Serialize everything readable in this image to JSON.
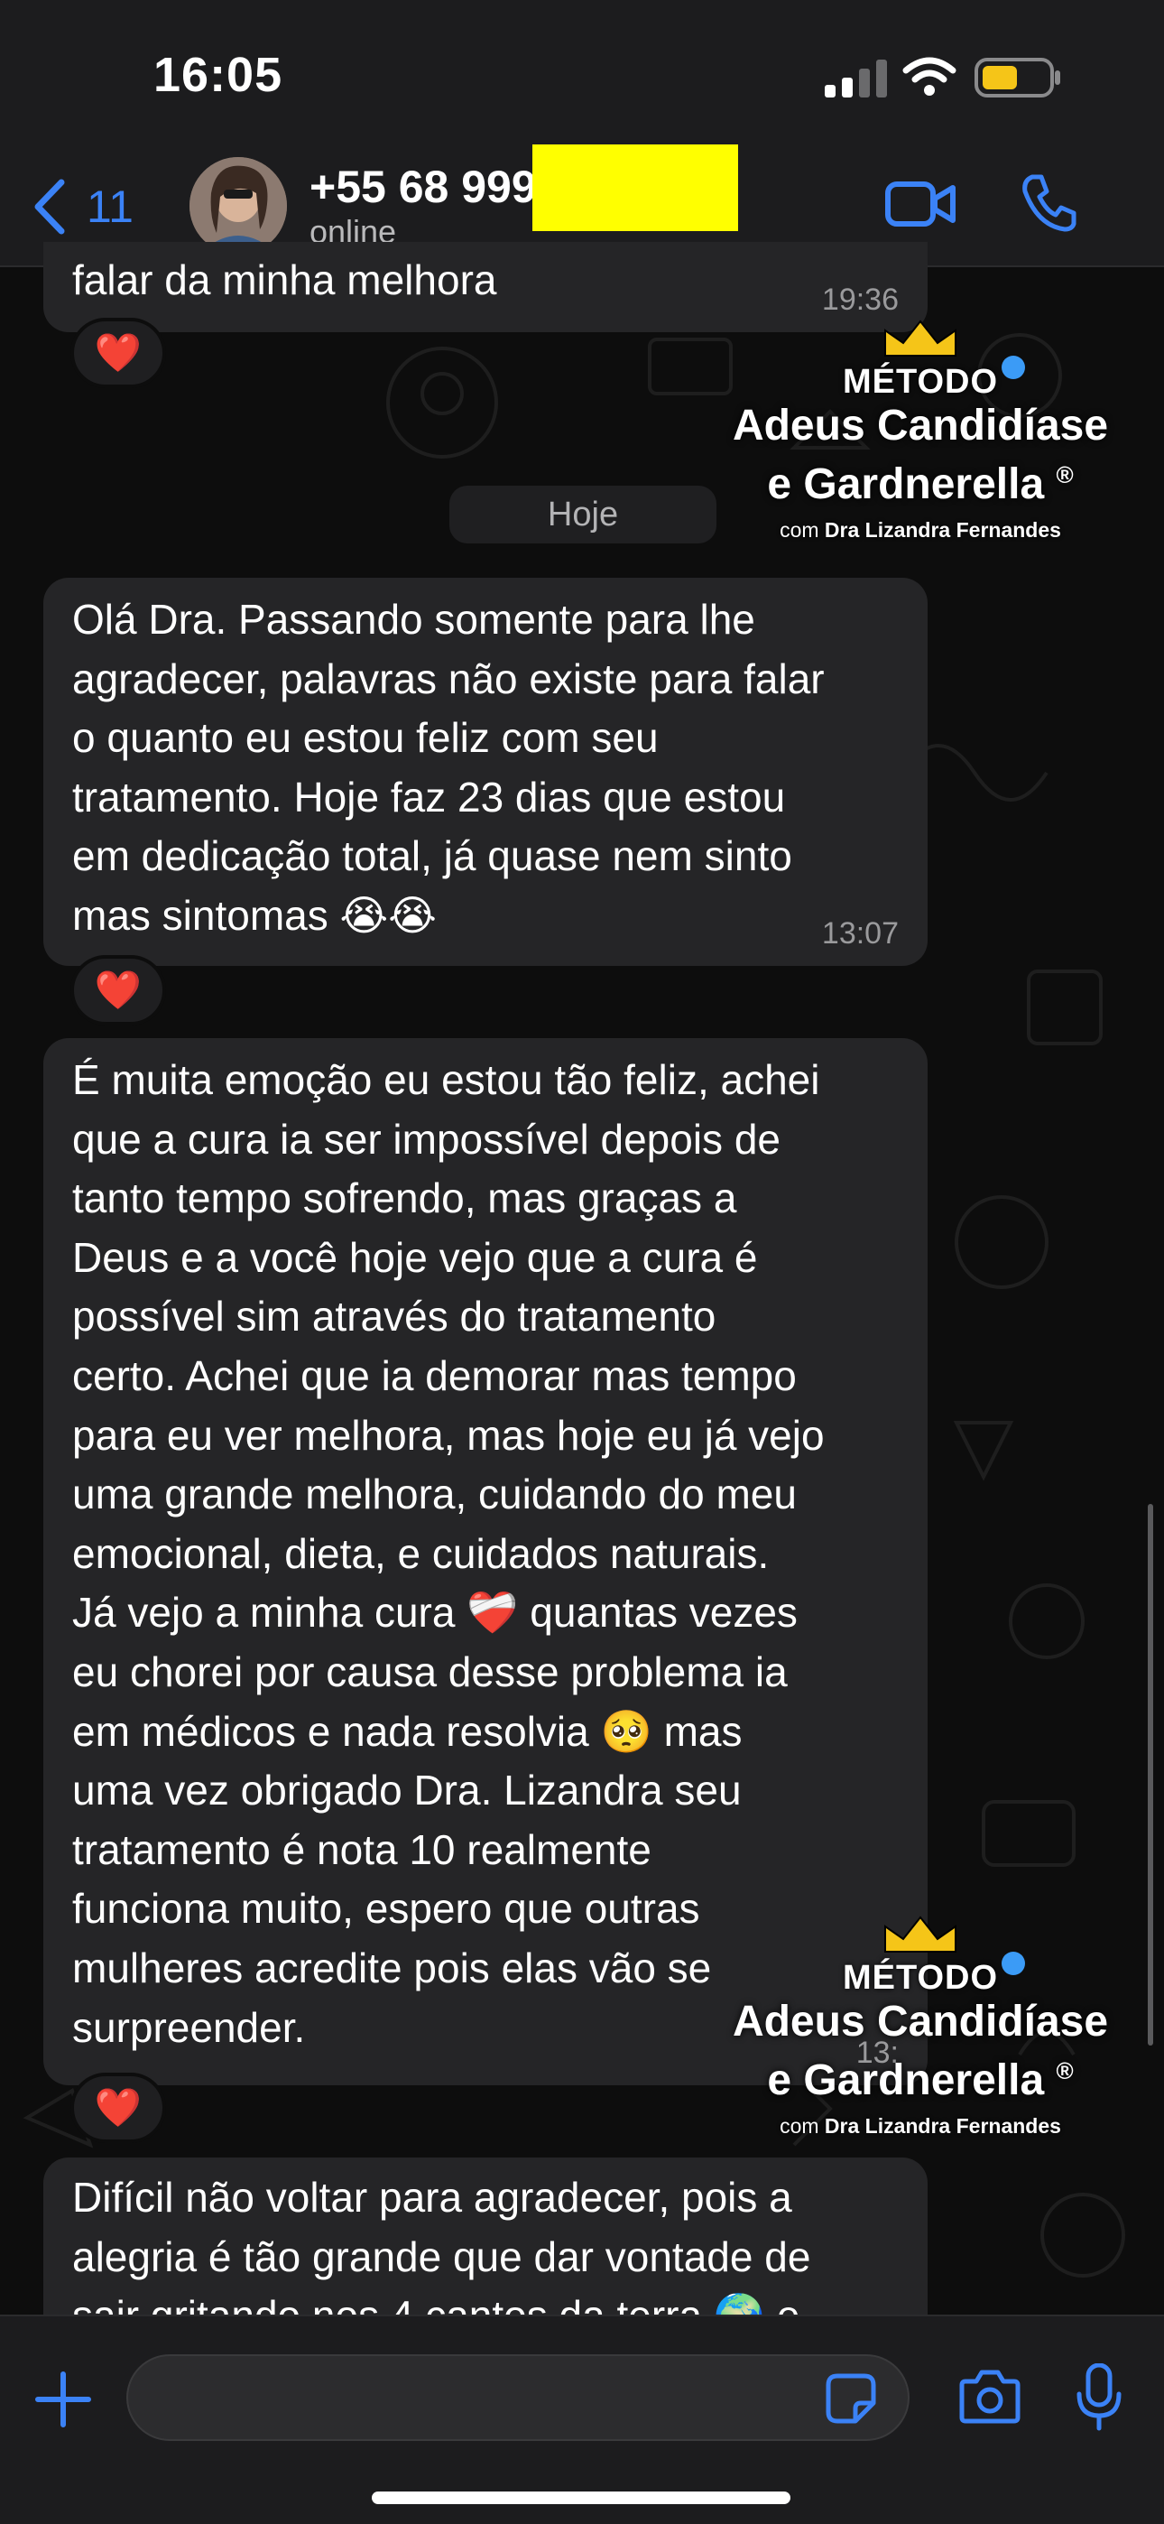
{
  "status_bar": {
    "time": "16:05"
  },
  "header": {
    "back_count": "11",
    "contact_name": "+55 68 999",
    "contact_status": "online"
  },
  "date_separator": "Hoje",
  "messages": [
    {
      "text": "falar da minha melhora",
      "time": "19:36",
      "reaction": "❤️"
    },
    {
      "text": "Olá Dra. Passando somente para lhe\nagradecer, palavras não existe para falar\no quanto eu estou feliz com seu\ntratamento. Hoje faz 23 dias que estou\nem dedicação total, já quase nem sinto\nmas sintomas 😭😭",
      "time": "13:07",
      "reaction": "❤️"
    },
    {
      "text": "É muita emoção eu estou tão feliz, achei\nque a cura ia ser impossível depois de\ntanto tempo sofrendo, mas graças a\nDeus e a você hoje vejo que a cura é\npossível sim através do tratamento\ncerto. Achei que ia demorar mas tempo\npara eu ver melhora, mas hoje eu já vejo\numa grande melhora, cuidando do meu\nemocional, dieta, e cuidados naturais.\nJá vejo a minha cura ❤️‍🩹 quantas vezes\neu chorei por causa desse problema ia\nem médicos e nada resolvia 🥺 mas\numa vez obrigado Dra. Lizandra seu\ntratamento é nota 10 realmente\nfunciona muito, espero que outras\nmulheres acredite pois elas vão se\nsurpreender.",
      "time": "13:",
      "reaction": "❤️"
    },
    {
      "text": "Difícil não voltar para agradecer, pois a\nalegria é tão grande que dar vontade de\nsair gritando nos 4 cantos da terra 🌍 e"
    }
  ],
  "watermark": {
    "metodo": "MÉTODO",
    "line1": "Adeus Candidíase",
    "line2": "e Gardnerella",
    "registered": "®",
    "by_prefix": "com",
    "by_name": "Dra Lizandra Fernandes"
  },
  "input": {
    "placeholder": ""
  },
  "colors": {
    "accent": "#3b82f6",
    "bubble": "#252527",
    "redaction": "#ffff00",
    "reaction": "#ff3b4e",
    "crown": "#f5c518"
  }
}
